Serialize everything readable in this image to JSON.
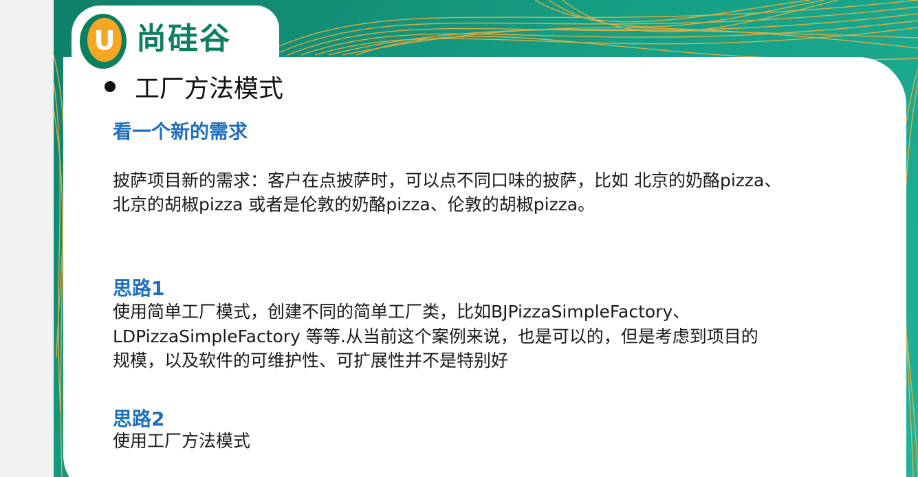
{
  "logo": {
    "badge_letter": "U",
    "brand_text": "尚硅谷"
  },
  "title": "工厂方法模式",
  "section_requirement": {
    "heading": "看一个新的需求",
    "lines": [
      "披萨项目新的需求：客户在点披萨时，可以点不同口味的披萨，比如 北京的奶酪pizza、",
      "北京的胡椒pizza 或者是伦敦的奶酪pizza、伦敦的胡椒pizza。"
    ]
  },
  "section_idea1": {
    "heading": "思路1",
    "lines": [
      "使用简单工厂模式，创建不同的简单工厂类，比如BJPizzaSimpleFactory、",
      "LDPizzaSimpleFactory 等等.从当前这个案例来说，也是可以的，但是考虑到项目的",
      "规模，以及软件的可维护性、可扩展性并不是特别好"
    ]
  },
  "section_idea2": {
    "heading": "思路2",
    "lines": [
      "使用工厂方法模式"
    ]
  },
  "colors": {
    "teal_background": "#16a085",
    "heading_blue": "#1f6fbf",
    "logo_green": "#0c7f5f",
    "logo_orange": "#f5a623",
    "deco_lines": "#f0b040"
  }
}
